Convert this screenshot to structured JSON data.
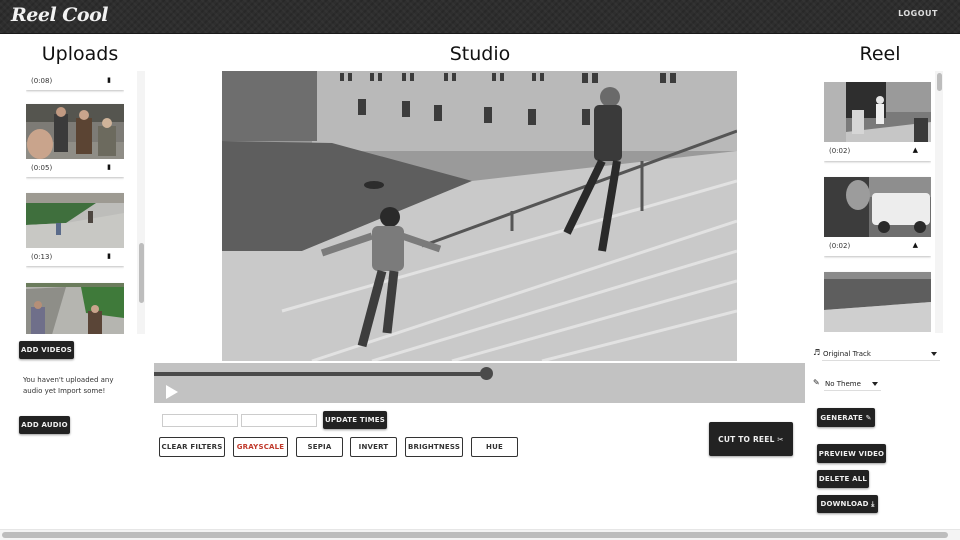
{
  "app": {
    "title": "Reel Cool",
    "logout_label": "LOGOUT"
  },
  "uploads": {
    "title": "Uploads",
    "clips": [
      {
        "duration": "(0:08)",
        "action_icon": "trash-icon",
        "action_glyph": "▮",
        "scene": "partial"
      },
      {
        "duration": "(0:05)",
        "action_icon": "trash-icon",
        "action_glyph": "▮",
        "scene": "selfie-group"
      },
      {
        "duration": "(0:13)",
        "action_icon": "trash-icon",
        "action_glyph": "▮",
        "scene": "stairs-lawn"
      },
      {
        "duration": "",
        "action_icon": "trash-icon",
        "action_glyph": "▮",
        "scene": "walkway-lawn"
      }
    ],
    "add_videos_label": "ADD VIDEOS",
    "audio_message": "You haven't uploaded any audio yet Import some!",
    "add_audio_label": "ADD AUDIO"
  },
  "studio": {
    "title": "Studio",
    "playback_progress": 0.51,
    "start_time_value": "",
    "end_time_value": "",
    "update_times_label": "UPDATE TIMES",
    "filters": [
      {
        "label": "CLEAR FILTERS",
        "active": false
      },
      {
        "label": "GRAYSCALE",
        "active": true
      },
      {
        "label": "SEPIA",
        "active": false
      },
      {
        "label": "INVERT",
        "active": false
      },
      {
        "label": "BRIGHTNESS",
        "active": false
      },
      {
        "label": "HUE",
        "active": false
      }
    ],
    "cut_to_reel_label": "CUT TO REEL ✂"
  },
  "reel": {
    "title": "Reel",
    "clips": [
      {
        "duration": "(0:02)",
        "action_glyph": "▲"
      },
      {
        "duration": "(0:02)",
        "action_glyph": "▲"
      },
      {
        "duration": "",
        "action_glyph": ""
      }
    ],
    "audio_track": {
      "icon_glyph": "♬",
      "value": "Original Track"
    },
    "theme": {
      "icon_glyph": "✎",
      "value": "No Theme"
    },
    "generate_label": "GENERATE ✎",
    "preview_label": "PREVIEW VIDEO",
    "delete_all_label": "DELETE ALL",
    "download_label": "DOWNLOAD ⤓"
  }
}
